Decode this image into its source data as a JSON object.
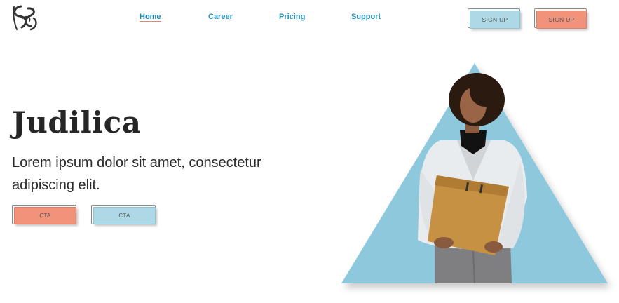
{
  "brand": {
    "logo_icon": "stylized-s-logo-icon"
  },
  "nav": {
    "items": [
      {
        "label": "Home",
        "active": true
      },
      {
        "label": "Career",
        "active": false
      },
      {
        "label": "Pricing",
        "active": false
      },
      {
        "label": "Support",
        "active": false
      }
    ]
  },
  "header_buttons": [
    {
      "label": "SIGN UP",
      "color": "#add8e6"
    },
    {
      "label": "SIGN UP",
      "color": "#f0937a"
    }
  ],
  "hero": {
    "title": "Judilica",
    "subtitle": "Lorem ipsum dolor sit amet, consectetur adipiscing elit.",
    "cta_buttons": [
      {
        "label": "CTA",
        "color": "#f0937a"
      },
      {
        "label": "CTA",
        "color": "#add8e6"
      }
    ],
    "image": "woman-holding-folder-photo",
    "shape": "triangle",
    "shape_color": "#8ec8dc"
  },
  "colors": {
    "accent_blue": "#2a8fb5",
    "salmon": "#f0937a",
    "light_blue": "#add8e6"
  }
}
